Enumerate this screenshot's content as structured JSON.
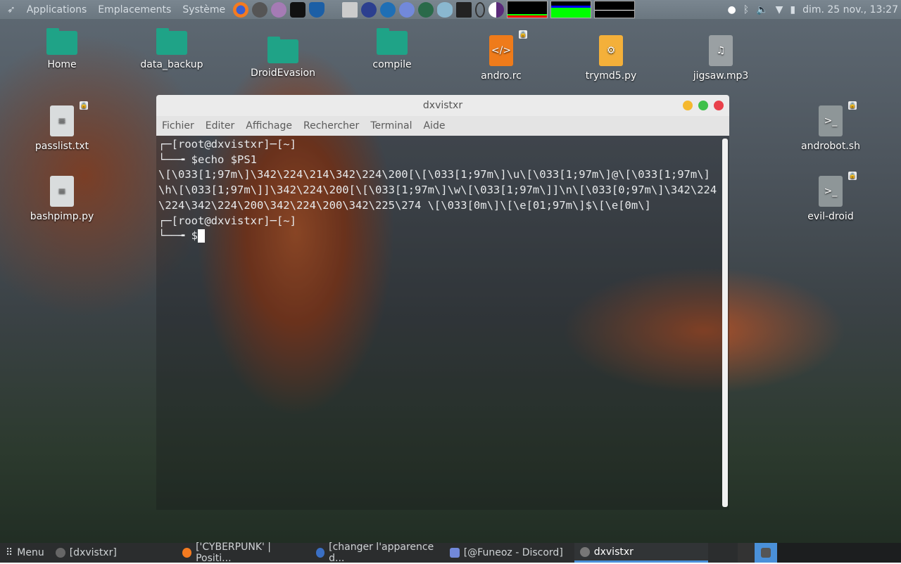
{
  "top_panel": {
    "menus": [
      "Applications",
      "Emplacements",
      "Système"
    ],
    "launchers": [
      "firefox-icon",
      "terminal-icon",
      "text-editor-icon",
      "hacker-app-icon",
      "metasploit-icon",
      "alien-icon",
      "vscode-icon",
      "wireshark-icon",
      "discord-icon",
      "kali-dragon-icon",
      "eye-icon",
      "network-tool-icon",
      "lightbulb-icon",
      "tor-browser-icon"
    ],
    "clock": "dim. 25 nov., 13:27"
  },
  "desktop_icons": [
    {
      "label": "Home",
      "type": "folder-home"
    },
    {
      "label": "data_backup",
      "type": "folder"
    },
    {
      "label": "DroidEvasion",
      "type": "folder"
    },
    {
      "label": "compile",
      "type": "folder"
    },
    {
      "label": "andro.rc",
      "type": "code-file",
      "locked": true
    },
    {
      "label": "trymd5.py",
      "type": "python-file"
    },
    {
      "label": "jigsaw.mp3",
      "type": "audio-file"
    },
    {
      "label": "passlist.txt",
      "type": "text-file",
      "locked": true
    },
    {
      "label": "bashpimp.py",
      "type": "text-file"
    },
    {
      "label": "androbot.sh",
      "type": "script-file",
      "locked": true
    },
    {
      "label": "evil-droid",
      "type": "script-file",
      "locked": true
    }
  ],
  "terminal": {
    "title": "dxvistxr",
    "menu": [
      "Fichier",
      "Editer",
      "Affichage",
      "Rechercher",
      "Terminal",
      "Aide"
    ],
    "lines": [
      "┌─[root@dxvistxr]─[~]",
      "└──╼ $echo $PS1",
      "\\[\\033[1;97m\\]\\342\\224\\214\\342\\224\\200[\\[\\033[1;97m\\]\\u\\[\\033[1;97m\\]@\\[\\033[1;97m\\]\\h\\[\\033[1;97m\\]]\\342\\224\\200[\\[\\033[1;97m\\]\\w\\[\\033[1;97m\\]]\\n\\[\\033[0;97m\\]\\342\\224\\224\\342\\224\\200\\342\\224\\200\\342\\225\\274 \\[\\033[0m\\]\\[\\e[01;97m\\]$\\[\\e[0m\\]",
      "┌─[root@dxvistxr]─[~]",
      "└──╼ $"
    ]
  },
  "taskbar": {
    "menu": "Menu",
    "tasks": [
      "[dxvistxr]",
      "['CYBERPUNK' | Positi...",
      "[changer l'apparence d...",
      "[@Funeoz - Discord]",
      "dxvistxr"
    ]
  }
}
